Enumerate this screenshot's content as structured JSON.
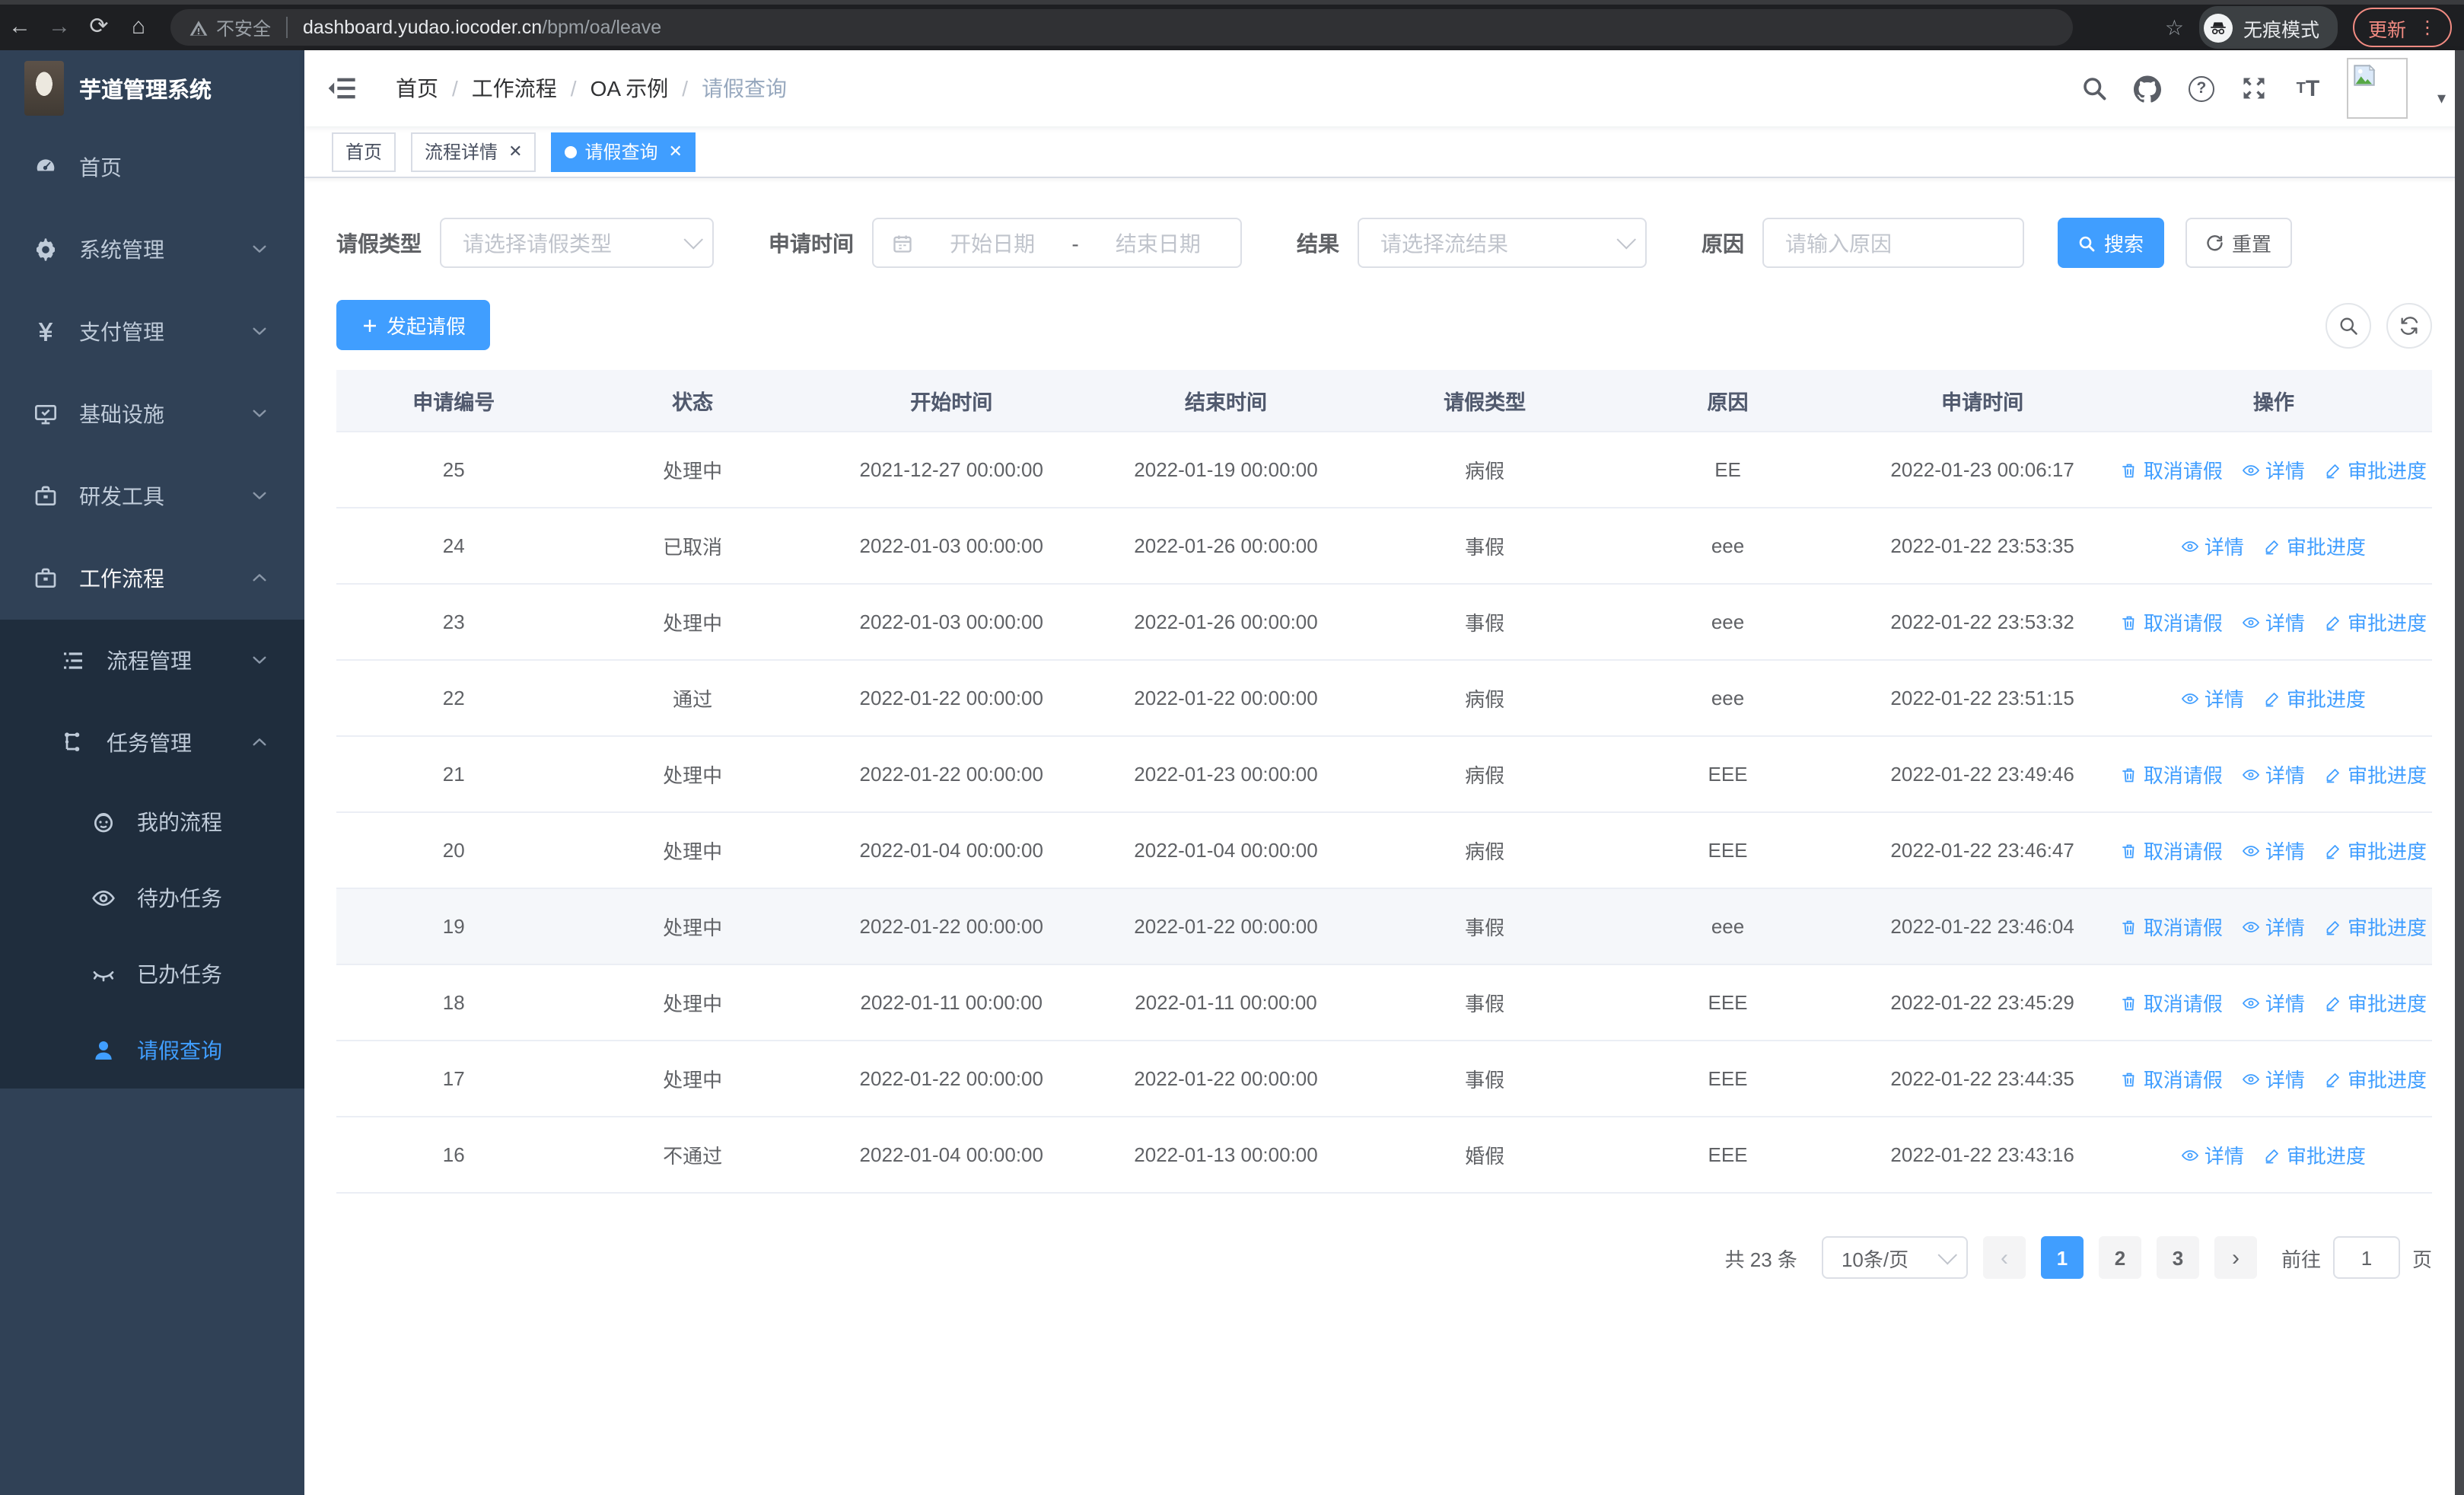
{
  "browser": {
    "security_label": "不安全",
    "url_host": "dashboard.yudao.iocoder.cn",
    "url_path": "/bpm/oa/leave",
    "incognito_label": "无痕模式",
    "update_label": "更新"
  },
  "sidebar": {
    "logo_title": "芋道管理系统",
    "items": [
      {
        "label": "首页",
        "icon": "dashboard-icon",
        "chevron": ""
      },
      {
        "label": "系统管理",
        "icon": "gear-icon",
        "chevron": "down"
      },
      {
        "label": "支付管理",
        "icon": "yen-icon",
        "chevron": "down"
      },
      {
        "label": "基础设施",
        "icon": "monitor-icon",
        "chevron": "down"
      },
      {
        "label": "研发工具",
        "icon": "toolbox-icon",
        "chevron": "down"
      },
      {
        "label": "工作流程",
        "icon": "briefcase-icon",
        "chevron": "up",
        "parentActive": true
      }
    ],
    "submenu": [
      {
        "label": "流程管理",
        "icon": "list-tree-icon",
        "chevron": "down",
        "level": 1
      },
      {
        "label": "任务管理",
        "icon": "share-node-icon",
        "chevron": "up",
        "level": 1
      },
      {
        "label": "我的流程",
        "icon": "face-icon",
        "level": 2
      },
      {
        "label": "待办任务",
        "icon": "eye-open-icon",
        "level": 2
      },
      {
        "label": "已办任务",
        "icon": "eye-closed-icon",
        "level": 2
      },
      {
        "label": "请假查询",
        "icon": "user-icon",
        "level": 2,
        "active": true
      }
    ]
  },
  "navbar": {
    "breadcrumb": [
      "首页",
      "工作流程",
      "OA 示例",
      "请假查询"
    ]
  },
  "tags": [
    {
      "label": "首页",
      "closable": false,
      "active": false
    },
    {
      "label": "流程详情",
      "closable": true,
      "active": false
    },
    {
      "label": "请假查询",
      "closable": true,
      "active": true
    }
  ],
  "filters": {
    "leave_type_label": "请假类型",
    "leave_type_placeholder": "请选择请假类型",
    "apply_time_label": "申请时间",
    "date_start_placeholder": "开始日期",
    "date_separator": "-",
    "date_end_placeholder": "结束日期",
    "result_label": "结果",
    "result_placeholder": "请选择流结果",
    "reason_label": "原因",
    "reason_placeholder": "请输入原因",
    "search_button": "搜索",
    "reset_button": "重置"
  },
  "toolbar": {
    "create_button": "发起请假"
  },
  "table": {
    "columns": [
      "申请编号",
      "状态",
      "开始时间",
      "结束时间",
      "请假类型",
      "原因",
      "申请时间",
      "操作"
    ],
    "action_labels": {
      "cancel": "取消请假",
      "detail": "详情",
      "progress": "审批进度"
    },
    "rows": [
      {
        "id": "25",
        "status": "处理中",
        "start": "2021-12-27 00:00:00",
        "end": "2022-01-19 00:00:00",
        "type": "病假",
        "reason": "EE",
        "apply": "2022-01-23 00:06:17",
        "cancelable": true,
        "highlight": false
      },
      {
        "id": "24",
        "status": "已取消",
        "start": "2022-01-03 00:00:00",
        "end": "2022-01-26 00:00:00",
        "type": "事假",
        "reason": "eee",
        "apply": "2022-01-22 23:53:35",
        "cancelable": false,
        "highlight": false
      },
      {
        "id": "23",
        "status": "处理中",
        "start": "2022-01-03 00:00:00",
        "end": "2022-01-26 00:00:00",
        "type": "事假",
        "reason": "eee",
        "apply": "2022-01-22 23:53:32",
        "cancelable": true,
        "highlight": false
      },
      {
        "id": "22",
        "status": "通过",
        "start": "2022-01-22 00:00:00",
        "end": "2022-01-22 00:00:00",
        "type": "病假",
        "reason": "eee",
        "apply": "2022-01-22 23:51:15",
        "cancelable": false,
        "highlight": false
      },
      {
        "id": "21",
        "status": "处理中",
        "start": "2022-01-22 00:00:00",
        "end": "2022-01-23 00:00:00",
        "type": "病假",
        "reason": "EEE",
        "apply": "2022-01-22 23:49:46",
        "cancelable": true,
        "highlight": false
      },
      {
        "id": "20",
        "status": "处理中",
        "start": "2022-01-04 00:00:00",
        "end": "2022-01-04 00:00:00",
        "type": "病假",
        "reason": "EEE",
        "apply": "2022-01-22 23:46:47",
        "cancelable": true,
        "highlight": false
      },
      {
        "id": "19",
        "status": "处理中",
        "start": "2022-01-22 00:00:00",
        "end": "2022-01-22 00:00:00",
        "type": "事假",
        "reason": "eee",
        "apply": "2022-01-22 23:46:04",
        "cancelable": true,
        "highlight": true
      },
      {
        "id": "18",
        "status": "处理中",
        "start": "2022-01-11 00:00:00",
        "end": "2022-01-11 00:00:00",
        "type": "事假",
        "reason": "EEE",
        "apply": "2022-01-22 23:45:29",
        "cancelable": true,
        "highlight": false
      },
      {
        "id": "17",
        "status": "处理中",
        "start": "2022-01-22 00:00:00",
        "end": "2022-01-22 00:00:00",
        "type": "事假",
        "reason": "EEE",
        "apply": "2022-01-22 23:44:35",
        "cancelable": true,
        "highlight": false
      },
      {
        "id": "16",
        "status": "不通过",
        "start": "2022-01-04 00:00:00",
        "end": "2022-01-13 00:00:00",
        "type": "婚假",
        "reason": "EEE",
        "apply": "2022-01-22 23:43:16",
        "cancelable": false,
        "highlight": false
      }
    ]
  },
  "pagination": {
    "total_label": "共 23 条",
    "page_size": "10条/页",
    "pages": [
      "1",
      "2",
      "3"
    ],
    "current_page": "1",
    "goto_label": "前往",
    "goto_value": "1",
    "page_suffix": "页"
  },
  "colors": {
    "primary": "#409eff",
    "sidebar_bg": "#304156",
    "submenu_bg": "#1f2d3d",
    "update_accent": "#f28b82"
  }
}
